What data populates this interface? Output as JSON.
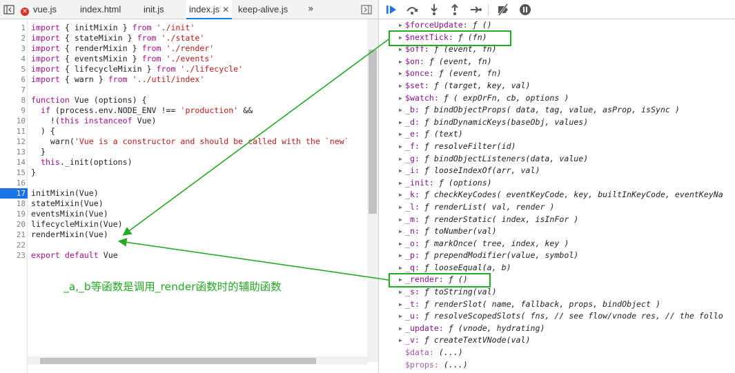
{
  "tabs": [
    {
      "label": "vue.js",
      "error": true
    },
    {
      "label": "index.html"
    },
    {
      "label": "init.js"
    },
    {
      "label": "index.js",
      "active": true,
      "closable": true
    },
    {
      "label": "keep-alive.js"
    }
  ],
  "tabs_more": "»",
  "source": {
    "active_line": 17,
    "lines": [
      {
        "n": "1",
        "html": "<span class=\"kw\">import</span> { initMixin } <span class=\"kw\">from</span> <span class=\"str\">'./init'</span>"
      },
      {
        "n": "2",
        "html": "<span class=\"kw\">import</span> { stateMixin } <span class=\"kw\">from</span> <span class=\"str\">'./state'</span>"
      },
      {
        "n": "3",
        "html": "<span class=\"kw\">import</span> { renderMixin } <span class=\"kw\">from</span> <span class=\"str\">'./render'</span>"
      },
      {
        "n": "4",
        "html": "<span class=\"kw\">import</span> { eventsMixin } <span class=\"kw\">from</span> <span class=\"str\">'./events'</span>"
      },
      {
        "n": "5",
        "html": "<span class=\"kw\">import</span> { lifecycleMixin } <span class=\"kw\">from</span> <span class=\"str\">'./lifecycle'</span>"
      },
      {
        "n": "6",
        "html": "<span class=\"kw\">import</span> { warn } <span class=\"kw\">from</span> <span class=\"str\">'../util/index'</span>"
      },
      {
        "n": "7",
        "html": ""
      },
      {
        "n": "8",
        "html": "<span class=\"kw\">function</span> Vue (options) {"
      },
      {
        "n": "9",
        "html": "  <span class=\"kw\">if</span> (process.env.NODE_ENV !== <span class=\"str\">'production'</span> &amp;&amp;"
      },
      {
        "n": "10",
        "html": "    !(<span class=\"kw\">this</span> <span class=\"kw\">instanceof</span> Vue)"
      },
      {
        "n": "11",
        "html": "  ) {"
      },
      {
        "n": "12",
        "html": "    warn(<span class=\"str\">'Vue is a constructor and should be called with the `new`</span>"
      },
      {
        "n": "13",
        "html": "  }"
      },
      {
        "n": "14",
        "html": "  <span class=\"kw\">this</span>._init(options)"
      },
      {
        "n": "15",
        "html": "}"
      },
      {
        "n": "16",
        "html": ""
      },
      {
        "n": "17",
        "html": "initMixin(Vue)"
      },
      {
        "n": "18",
        "html": "stateMixin(Vue)"
      },
      {
        "n": "19",
        "html": "eventsMixin(Vue)"
      },
      {
        "n": "20",
        "html": "lifecycleMixin(Vue)"
      },
      {
        "n": "21",
        "html": "renderMixin(Vue)"
      },
      {
        "n": "22",
        "html": ""
      },
      {
        "n": "23",
        "html": "<span class=\"kw\">export</span> <span class=\"kw\">default</span> Vue"
      }
    ]
  },
  "annotation": "_a,_b等函数是调用_render函数时的辅助函数",
  "scope_props": [
    {
      "key": "$forceUpdate",
      "val": "ƒ ()",
      "expand": true
    },
    {
      "key": "$nextTick",
      "val": "ƒ (fn)",
      "expand": true
    },
    {
      "key": "$off",
      "val": "ƒ (event, fn)",
      "expand": true
    },
    {
      "key": "$on",
      "val": "ƒ (event, fn)",
      "expand": true
    },
    {
      "key": "$once",
      "val": "ƒ (event, fn)",
      "expand": true
    },
    {
      "key": "$set",
      "val": "ƒ (target, key, val)",
      "expand": true
    },
    {
      "key": "$watch",
      "val": "ƒ ( expOrFn, cb, options )",
      "expand": true
    },
    {
      "key": "_b",
      "val": "ƒ bindObjectProps( data, tag, value, asProp, isSync )",
      "expand": true
    },
    {
      "key": "_d",
      "val": "ƒ bindDynamicKeys(baseObj, values)",
      "expand": true
    },
    {
      "key": "_e",
      "val": "ƒ (text)",
      "expand": true
    },
    {
      "key": "_f",
      "val": "ƒ resolveFilter(id)",
      "expand": true
    },
    {
      "key": "_g",
      "val": "ƒ bindObjectListeners(data, value)",
      "expand": true
    },
    {
      "key": "_i",
      "val": "ƒ looseIndexOf(arr, val)",
      "expand": true
    },
    {
      "key": "_init",
      "val": "ƒ (options)",
      "expand": true
    },
    {
      "key": "_k",
      "val": "ƒ checkKeyCodes( eventKeyCode, key, builtInKeyCode, eventKeyNa",
      "expand": true
    },
    {
      "key": "_l",
      "val": "ƒ renderList( val, render )",
      "expand": true
    },
    {
      "key": "_m",
      "val": "ƒ renderStatic( index, isInFor )",
      "expand": true
    },
    {
      "key": "_n",
      "val": "ƒ toNumber(val)",
      "expand": true
    },
    {
      "key": "_o",
      "val": "ƒ markOnce( tree, index, key )",
      "expand": true
    },
    {
      "key": "_p",
      "val": "ƒ prependModifier(value, symbol)",
      "expand": true
    },
    {
      "key": "_q",
      "val": "ƒ looseEqual(a, b)",
      "expand": true
    },
    {
      "key": "_render",
      "val": "ƒ ()",
      "expand": true
    },
    {
      "key": "_s",
      "val": "ƒ toString(val)",
      "expand": true
    },
    {
      "key": "_t",
      "val": "ƒ renderSlot( name, fallback, props, bindObject )",
      "expand": true
    },
    {
      "key": "_u",
      "val": "ƒ resolveScopedSlots( fns, // see flow/vnode res, // the follo",
      "expand": true
    },
    {
      "key": "_update",
      "val": "ƒ (vnode, hydrating)",
      "expand": true
    },
    {
      "key": "_v",
      "val": "ƒ createTextVNode(val)",
      "expand": true
    },
    {
      "key": "$data",
      "val": "(...)",
      "expand": false,
      "dim": true
    },
    {
      "key": "$props",
      "val": "(...)",
      "expand": false,
      "dim": true
    }
  ],
  "colors": {
    "accent": "#1a73e8",
    "annotation": "#22aa22",
    "keyword": "#aa0d91",
    "string": "#c41a16",
    "property": "#881391"
  }
}
